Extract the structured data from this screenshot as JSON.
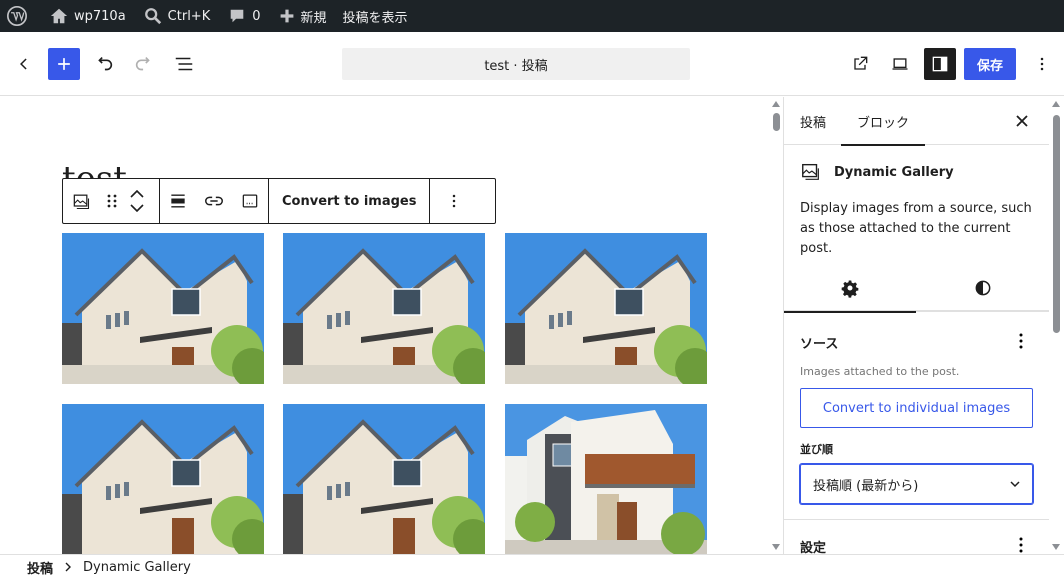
{
  "adminbar": {
    "site_name": "wp710a",
    "search_shortcut": "Ctrl+K",
    "comments_count": "0",
    "new_label": "新規",
    "view_post_label": "投稿を表示"
  },
  "header": {
    "document_title": "test · 投稿",
    "save_label": "保存"
  },
  "canvas": {
    "post_title": "test",
    "toolbar": {
      "convert_label": "Convert to images"
    },
    "gallery_images": [
      {
        "style": "house-a"
      },
      {
        "style": "house-a"
      },
      {
        "style": "house-a"
      },
      {
        "style": "house-a"
      },
      {
        "style": "house-a"
      },
      {
        "style": "house-b"
      }
    ]
  },
  "sidebar": {
    "tabs": [
      "投稿",
      "ブロック"
    ],
    "block": {
      "name": "Dynamic Gallery",
      "description": "Display images from a source, such as those attached to the current post."
    },
    "source_panel": {
      "title": "ソース",
      "help": "Images attached to the post.",
      "convert_button": "Convert to individual images",
      "order_label": "並び順",
      "order_value": "投稿順 (最新から)"
    },
    "settings_panel": {
      "title": "設定"
    }
  },
  "footer": {
    "crumbs": [
      "投稿",
      "Dynamic Gallery"
    ]
  },
  "colors": {
    "accent": "#3858e9",
    "adminbar": "#1d2327"
  }
}
